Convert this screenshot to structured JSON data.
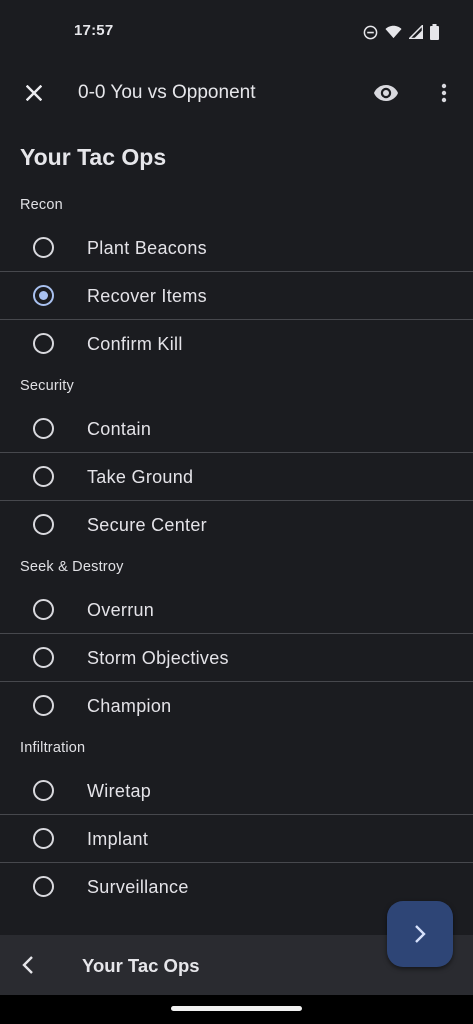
{
  "status_bar": {
    "time": "17:57",
    "icons": [
      "do-not-disturb-icon",
      "wifi-icon",
      "signal-icon",
      "battery-icon"
    ]
  },
  "app_bar": {
    "title": "0-0 You vs Opponent",
    "icons": [
      "close-icon",
      "eye-icon",
      "more-vert-icon"
    ]
  },
  "page_heading": "Your Tac Ops",
  "sections": [
    {
      "title": "Recon",
      "options": [
        {
          "label": "Plant Beacons",
          "selected": false
        },
        {
          "label": "Recover Items",
          "selected": true
        },
        {
          "label": "Confirm Kill",
          "selected": false
        }
      ]
    },
    {
      "title": "Security",
      "options": [
        {
          "label": "Contain",
          "selected": false
        },
        {
          "label": "Take Ground",
          "selected": false
        },
        {
          "label": "Secure Center",
          "selected": false
        }
      ]
    },
    {
      "title": "Seek & Destroy",
      "options": [
        {
          "label": "Overrun",
          "selected": false
        },
        {
          "label": "Storm Objectives",
          "selected": false
        },
        {
          "label": "Champion",
          "selected": false
        }
      ]
    },
    {
      "title": "Infiltration",
      "options": [
        {
          "label": "Wiretap",
          "selected": false
        },
        {
          "label": "Implant",
          "selected": false
        },
        {
          "label": "Surveillance",
          "selected": false
        }
      ]
    }
  ],
  "fab": {
    "icon": "chevron-right-icon"
  },
  "bottom_bar": {
    "title": "Your Tac Ops",
    "icon": "chevron-left-icon"
  },
  "colors": {
    "background": "#1b1c20",
    "accent": "#a9c1f0",
    "fab": "#2e4576",
    "bottom_bar": "#2a2b30",
    "divider": "#47484d"
  }
}
